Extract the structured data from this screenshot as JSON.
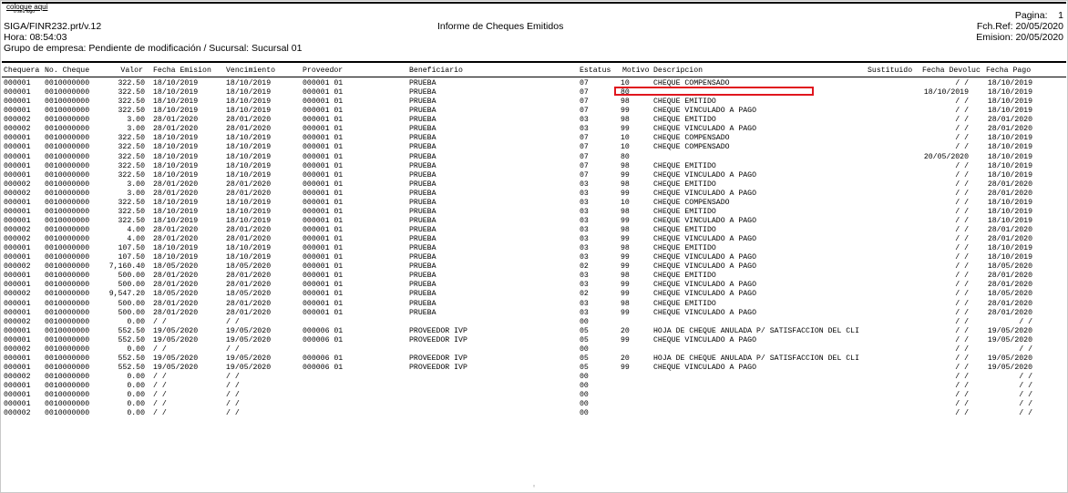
{
  "logo": {
    "line1": "coloque aqui",
    "line2": "o seu logo"
  },
  "header": {
    "program": "SIGA/FINR232.prt/v.12",
    "time": "Hora: 08:54:03",
    "group": "Grupo de empresa: Pendiente de modificación / Sucursal: Sucursal 01",
    "title": "Informe de Cheques Emitidos",
    "page": "Pagina:    1",
    "ref_date": "Fch.Ref: 20/05/2020",
    "emission": "Emision: 20/05/2020"
  },
  "columns": {
    "chequera": "Chequera",
    "no_cheque": "No. Cheque",
    "valor": "Valor",
    "fecha_emision": "Fecha Emision",
    "vencimiento": "Vencimiento",
    "proveedor": "Proveedor",
    "beneficiario": "Beneficiario",
    "estatus": "Estatus",
    "motivo": "Motivo",
    "descripcion": "Descripcion",
    "sustituido": "Sustituido",
    "fecha_devoluc": "Fecha Devoluc",
    "fecha_pago": "Fecha Pago"
  },
  "rows": [
    [
      "000001",
      "0010000000",
      "322.50",
      "18/10/2019",
      "18/10/2019",
      "000001 01",
      "PRUEBA",
      "07",
      "10",
      "CHEQUE COMPENSADO",
      "",
      "/  /",
      "18/10/2019"
    ],
    [
      "000001",
      "0010000000",
      "322.50",
      "18/10/2019",
      "18/10/2019",
      "000001 01",
      "PRUEBA",
      "07",
      "80",
      "",
      "",
      "18/10/2019",
      "18/10/2019"
    ],
    [
      "000001",
      "0010000000",
      "322.50",
      "18/10/2019",
      "18/10/2019",
      "000001 01",
      "PRUEBA",
      "07",
      "98",
      "CHEQUE EMITIDO",
      "",
      "/  /",
      "18/10/2019"
    ],
    [
      "000001",
      "0010000000",
      "322.50",
      "18/10/2019",
      "18/10/2019",
      "000001 01",
      "PRUEBA",
      "07",
      "99",
      "CHEQUE VINCULADO A PAGO",
      "",
      "/  /",
      "18/10/2019"
    ],
    [
      "000002",
      "0010000000",
      "3.00",
      "28/01/2020",
      "28/01/2020",
      "000001 01",
      "PRUEBA",
      "03",
      "98",
      "CHEQUE EMITIDO",
      "",
      "/  /",
      "28/01/2020"
    ],
    [
      "000002",
      "0010000000",
      "3.00",
      "28/01/2020",
      "28/01/2020",
      "000001 01",
      "PRUEBA",
      "03",
      "99",
      "CHEQUE VINCULADO A PAGO",
      "",
      "/  /",
      "28/01/2020"
    ],
    [
      "000001",
      "0010000000",
      "322.50",
      "18/10/2019",
      "18/10/2019",
      "000001 01",
      "PRUEBA",
      "07",
      "10",
      "CHEQUE COMPENSADO",
      "",
      "/  /",
      "18/10/2019"
    ],
    [
      "000001",
      "0010000000",
      "322.50",
      "18/10/2019",
      "18/10/2019",
      "000001 01",
      "PRUEBA",
      "07",
      "10",
      "CHEQUE COMPENSADO",
      "",
      "/  /",
      "18/10/2019"
    ],
    [
      "000001",
      "0010000000",
      "322.50",
      "18/10/2019",
      "18/10/2019",
      "000001 01",
      "PRUEBA",
      "07",
      "80",
      "",
      "",
      "20/05/2020",
      "18/10/2019"
    ],
    [
      "000001",
      "0010000000",
      "322.50",
      "18/10/2019",
      "18/10/2019",
      "000001 01",
      "PRUEBA",
      "07",
      "98",
      "CHEQUE EMITIDO",
      "",
      "/  /",
      "18/10/2019"
    ],
    [
      "000001",
      "0010000000",
      "322.50",
      "18/10/2019",
      "18/10/2019",
      "000001 01",
      "PRUEBA",
      "07",
      "99",
      "CHEQUE VINCULADO A PAGO",
      "",
      "/  /",
      "18/10/2019"
    ],
    [
      "000002",
      "0010000000",
      "3.00",
      "28/01/2020",
      "28/01/2020",
      "000001 01",
      "PRUEBA",
      "03",
      "98",
      "CHEQUE EMITIDO",
      "",
      "/  /",
      "28/01/2020"
    ],
    [
      "000002",
      "0010000000",
      "3.00",
      "28/01/2020",
      "28/01/2020",
      "000001 01",
      "PRUEBA",
      "03",
      "99",
      "CHEQUE VINCULADO A PAGO",
      "",
      "/  /",
      "28/01/2020"
    ],
    [
      "000001",
      "0010000000",
      "322.50",
      "18/10/2019",
      "18/10/2019",
      "000001 01",
      "PRUEBA",
      "03",
      "10",
      "CHEQUE COMPENSADO",
      "",
      "/  /",
      "18/10/2019"
    ],
    [
      "000001",
      "0010000000",
      "322.50",
      "18/10/2019",
      "18/10/2019",
      "000001 01",
      "PRUEBA",
      "03",
      "98",
      "CHEQUE EMITIDO",
      "",
      "/  /",
      "18/10/2019"
    ],
    [
      "000001",
      "0010000000",
      "322.50",
      "18/10/2019",
      "18/10/2019",
      "000001 01",
      "PRUEBA",
      "03",
      "99",
      "CHEQUE VINCULADO A PAGO",
      "",
      "/  /",
      "18/10/2019"
    ],
    [
      "000002",
      "0010000000",
      "4.00",
      "28/01/2020",
      "28/01/2020",
      "000001 01",
      "PRUEBA",
      "03",
      "98",
      "CHEQUE EMITIDO",
      "",
      "/  /",
      "28/01/2020"
    ],
    [
      "000002",
      "0010000000",
      "4.00",
      "28/01/2020",
      "28/01/2020",
      "000001 01",
      "PRUEBA",
      "03",
      "99",
      "CHEQUE VINCULADO A PAGO",
      "",
      "/  /",
      "28/01/2020"
    ],
    [
      "000001",
      "0010000000",
      "107.50",
      "18/10/2019",
      "18/10/2019",
      "000001 01",
      "PRUEBA",
      "03",
      "98",
      "CHEQUE EMITIDO",
      "",
      "/  /",
      "18/10/2019"
    ],
    [
      "000001",
      "0010000000",
      "107.50",
      "18/10/2019",
      "18/10/2019",
      "000001 01",
      "PRUEBA",
      "03",
      "99",
      "CHEQUE VINCULADO A PAGO",
      "",
      "/  /",
      "18/10/2019"
    ],
    [
      "000002",
      "0010000000",
      "7,160.40",
      "18/05/2020",
      "18/05/2020",
      "000001 01",
      "PRUEBA",
      "02",
      "99",
      "CHEQUE VINCULADO A PAGO",
      "",
      "/  /",
      "18/05/2020"
    ],
    [
      "000001",
      "0010000000",
      "500.00",
      "28/01/2020",
      "28/01/2020",
      "000001 01",
      "PRUEBA",
      "03",
      "98",
      "CHEQUE EMITIDO",
      "",
      "/  /",
      "28/01/2020"
    ],
    [
      "000001",
      "0010000000",
      "500.00",
      "28/01/2020",
      "28/01/2020",
      "000001 01",
      "PRUEBA",
      "03",
      "99",
      "CHEQUE VINCULADO A PAGO",
      "",
      "/  /",
      "28/01/2020"
    ],
    [
      "000002",
      "0010000000",
      "9,547.20",
      "18/05/2020",
      "18/05/2020",
      "000001 01",
      "PRUEBA",
      "02",
      "99",
      "CHEQUE VINCULADO A PAGO",
      "",
      "/  /",
      "18/05/2020"
    ],
    [
      "000001",
      "0010000000",
      "500.00",
      "28/01/2020",
      "28/01/2020",
      "000001 01",
      "PRUEBA",
      "03",
      "98",
      "CHEQUE EMITIDO",
      "",
      "/  /",
      "28/01/2020"
    ],
    [
      "000001",
      "0010000000",
      "500.00",
      "28/01/2020",
      "28/01/2020",
      "000001 01",
      "PRUEBA",
      "03",
      "99",
      "CHEQUE VINCULADO A PAGO",
      "",
      "/  /",
      "28/01/2020"
    ],
    [
      "000002",
      "0010000000",
      "0.00",
      "/  /",
      "/  /",
      "",
      "",
      "00",
      "",
      "",
      "",
      "/  /",
      "/  /"
    ],
    [
      "000001",
      "0010000000",
      "552.50",
      "19/05/2020",
      "19/05/2020",
      "000006 01",
      "PROVEEDOR IVP",
      "05",
      "20",
      "HOJA DE CHEQUE ANULADA P/ SATISFACCION DEL CLI",
      "",
      "/  /",
      "19/05/2020"
    ],
    [
      "000001",
      "0010000000",
      "552.50",
      "19/05/2020",
      "19/05/2020",
      "000006 01",
      "PROVEEDOR IVP",
      "05",
      "99",
      "CHEQUE VINCULADO A PAGO",
      "",
      "/  /",
      "19/05/2020"
    ],
    [
      "000002",
      "0010000000",
      "0.00",
      "/  /",
      "/  /",
      "",
      "",
      "00",
      "",
      "",
      "",
      "/  /",
      "/  /"
    ],
    [
      "000001",
      "0010000000",
      "552.50",
      "19/05/2020",
      "19/05/2020",
      "000006 01",
      "PROVEEDOR IVP",
      "05",
      "20",
      "HOJA DE CHEQUE ANULADA P/ SATISFACCION DEL CLI",
      "",
      "/  /",
      "19/05/2020"
    ],
    [
      "000001",
      "0010000000",
      "552.50",
      "19/05/2020",
      "19/05/2020",
      "000006 01",
      "PROVEEDOR IVP",
      "05",
      "99",
      "CHEQUE VINCULADO A PAGO",
      "",
      "/  /",
      "19/05/2020"
    ],
    [
      "000002",
      "0010000000",
      "0.00",
      "/  /",
      "/  /",
      "",
      "",
      "00",
      "",
      "",
      "",
      "/  /",
      "/  /"
    ],
    [
      "000001",
      "0010000000",
      "0.00",
      "/  /",
      "/  /",
      "",
      "",
      "00",
      "",
      "",
      "",
      "/  /",
      "/  /"
    ],
    [
      "000001",
      "0010000000",
      "0.00",
      "/  /",
      "/  /",
      "",
      "",
      "00",
      "",
      "",
      "",
      "/  /",
      "/  /"
    ],
    [
      "000001",
      "0010000000",
      "0.00",
      "/  /",
      "/  /",
      "",
      "",
      "00",
      "",
      "",
      "",
      "/  /",
      "/  /"
    ],
    [
      "000002",
      "0010000000",
      "0.00",
      "/  /",
      "/  /",
      "",
      "",
      "00",
      "",
      "",
      "",
      "/  /",
      "/  /"
    ]
  ],
  "highlight_color": "#e0161e"
}
